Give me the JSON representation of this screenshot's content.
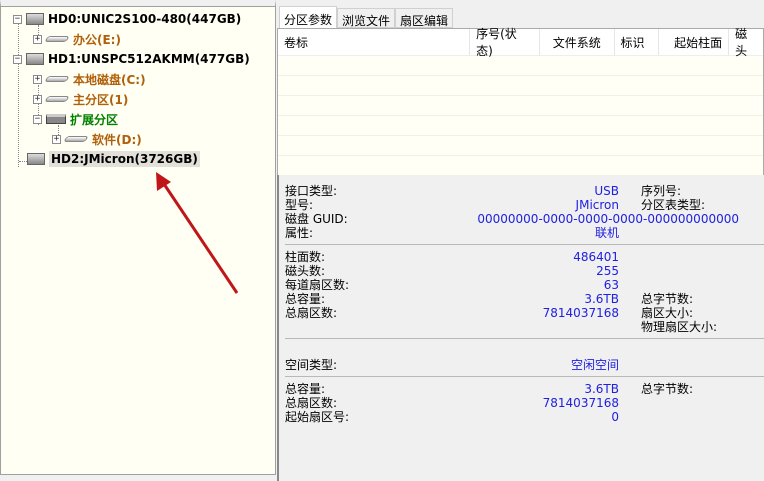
{
  "tree": {
    "disks": [
      {
        "label": "HD0:UNIC2S100-480(447GB)",
        "partitions": [
          {
            "label": "办公(E:)"
          }
        ]
      },
      {
        "label": "HD1:UNSPC512AKMM(477GB)",
        "partitions": [
          {
            "label": "本地磁盘(C:)"
          },
          {
            "label": "主分区(1)"
          },
          {
            "label": "扩展分区"
          },
          {
            "label": "软件(D:)"
          }
        ]
      },
      {
        "label": "HD2:JMicron(3726GB)"
      }
    ]
  },
  "tabs": [
    "分区参数",
    "浏览文件",
    "扇区编辑"
  ],
  "columns": [
    "卷标",
    "序号(状态)",
    "文件系统",
    "标识",
    "起始柱面",
    "磁头"
  ],
  "info": {
    "interface_label": "接口类型:",
    "interface": "USB",
    "serial_label": "序列号:",
    "model_label": "型号:",
    "model": "JMicron",
    "pt_label": "分区表类型:",
    "guid_label": "磁盘 GUID:",
    "guid": "00000000-0000-0000-0000-000000000000",
    "attr_label": "属性:",
    "attr": "联机",
    "cyl_label": "柱面数:",
    "cyl": "486401",
    "heads_label": "磁头数:",
    "heads": "255",
    "spt_label": "每道扇区数:",
    "spt": "63",
    "cap_label": "总容量:",
    "cap": "3.6TB",
    "bytes_label": "总字节数:",
    "sectors_label": "总扇区数:",
    "sectors": "7814037168",
    "secsize_label": "扇区大小:",
    "physsec_label": "物理扇区大小:",
    "space_label": "空间类型:",
    "space": "空闲空间",
    "cap2_label": "总容量:",
    "cap2": "3.6TB",
    "bytes2_label": "总字节数:",
    "sectors2_label": "总扇区数:",
    "sectors2": "7814037168",
    "start_label": "起始扇区号:",
    "start": "0"
  },
  "colors": {
    "arrow": "#c0161a",
    "value": "#2020e0",
    "partition": "#b0600a",
    "extended": "#008000"
  }
}
